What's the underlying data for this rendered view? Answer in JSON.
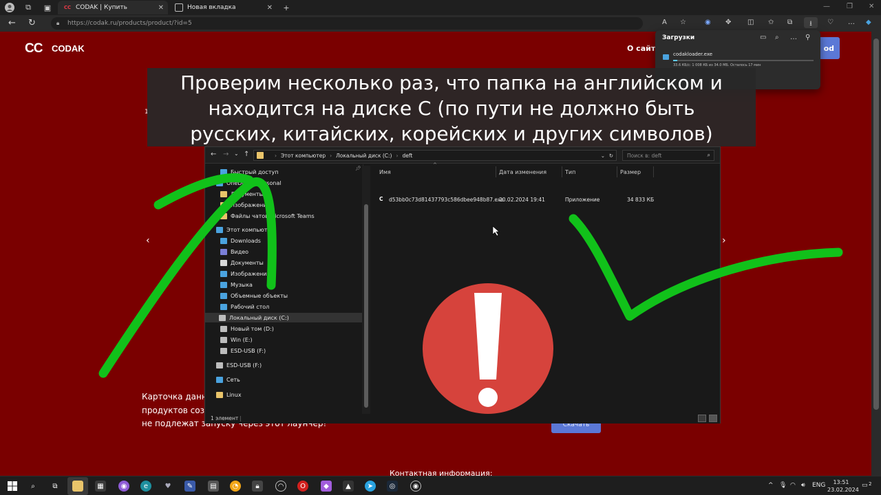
{
  "browser": {
    "tabs": [
      {
        "favicon": "CC",
        "label": "CODAK | Купить",
        "active": true
      },
      {
        "favicon": "newtab-icon",
        "label": "Новая вкладка",
        "active": false
      }
    ],
    "url": "https://codak.ru/products/product/?id=5"
  },
  "site": {
    "logo_mark": "CC",
    "logo_text": "CODAK",
    "nav_label": "О сайте",
    "header_button": "od",
    "card_text_line1": "Карточка данно",
    "card_text_line2": "продуктов созда",
    "card_text_line3": "не подлежат запуску через этот лаунчер!",
    "small_marker": "1",
    "button2_label": "Скачать",
    "contact": "Контактная информация:",
    "arrow_left": "‹",
    "arrow_right": "›"
  },
  "downloads": {
    "title": "Загрузки",
    "file_name": "codakloader.exe",
    "progress": 0.03,
    "status": "33.6 КБ/с: 1 008 КБ из 34.0 МБ. Осталось 17 мин"
  },
  "caption": {
    "line1": "Проверим несколько раз, что папка на английском и",
    "line2": "находится на диске С (по пути не должно быть",
    "line3": "русских, китайских, корейских и других символов)"
  },
  "explorer": {
    "breadcrumb": [
      "Этот компьютер",
      "Локальный диск (C:)",
      "deft"
    ],
    "search_placeholder": "Поиск в: deft",
    "sidebar": [
      {
        "label": "Быстрый доступ",
        "icon": "star-icon",
        "color": "#4aa3df"
      },
      {
        "label": "OneDrive - Personal",
        "icon": "cloud-icon",
        "color": "#4aa3df"
      },
      {
        "label": "Документы",
        "icon": "folder-icon",
        "color": "#e9c46a"
      },
      {
        "label": "Изображения",
        "icon": "folder-icon",
        "color": "#e9c46a"
      },
      {
        "label": "Файлы чатов Microsoft Teams",
        "icon": "folder-icon",
        "color": "#e9c46a"
      },
      {
        "label": "Этот компьютер",
        "icon": "computer-icon",
        "color": "#4aa3df"
      },
      {
        "label": "Downloads",
        "icon": "download-icon",
        "color": "#4aa3df"
      },
      {
        "label": "Видео",
        "icon": "video-icon",
        "color": "#7a7fd8"
      },
      {
        "label": "Документы",
        "icon": "document-icon",
        "color": "#d9d9d9"
      },
      {
        "label": "Изображения",
        "icon": "image-icon",
        "color": "#4aa3df"
      },
      {
        "label": "Музыка",
        "icon": "music-icon",
        "color": "#4aa3df"
      },
      {
        "label": "Объемные объекты",
        "icon": "cube-icon",
        "color": "#4aa3df"
      },
      {
        "label": "Рабочий стол",
        "icon": "desktop-icon",
        "color": "#4aa3df"
      },
      {
        "label": "Локальный диск (C:)",
        "icon": "drive-icon",
        "color": "#bdbdbd",
        "selected": true
      },
      {
        "label": "Новый том (D:)",
        "icon": "drive-icon",
        "color": "#bdbdbd"
      },
      {
        "label": "Win (E:)",
        "icon": "drive-icon",
        "color": "#bdbdbd"
      },
      {
        "label": "ESD-USB (F:)",
        "icon": "drive-icon",
        "color": "#bdbdbd"
      },
      {
        "label": "ESD-USB (F:)",
        "icon": "drive-icon",
        "color": "#bdbdbd"
      },
      {
        "label": "Сеть",
        "icon": "network-icon",
        "color": "#4aa3df"
      },
      {
        "label": "Linux",
        "icon": "linux-icon",
        "color": "#e9c46a"
      }
    ],
    "columns": [
      "Имя",
      "Дата изменения",
      "Тип",
      "Размер"
    ],
    "file": {
      "name": "d53bb0c73d81437793c586dbee948b87.exe",
      "date": "20.02.2024 19:41",
      "type": "Приложение",
      "size": "34 833 КБ"
    },
    "status": "1 элемент"
  },
  "overlays": {
    "warning_icon": "exclamation-icon",
    "arrow_color": "#11c11a",
    "warning_color": "#d6433c"
  },
  "taskbar": {
    "language": "ENG",
    "time": "13:51",
    "date": "23.02.2024",
    "notification_count": "2"
  }
}
